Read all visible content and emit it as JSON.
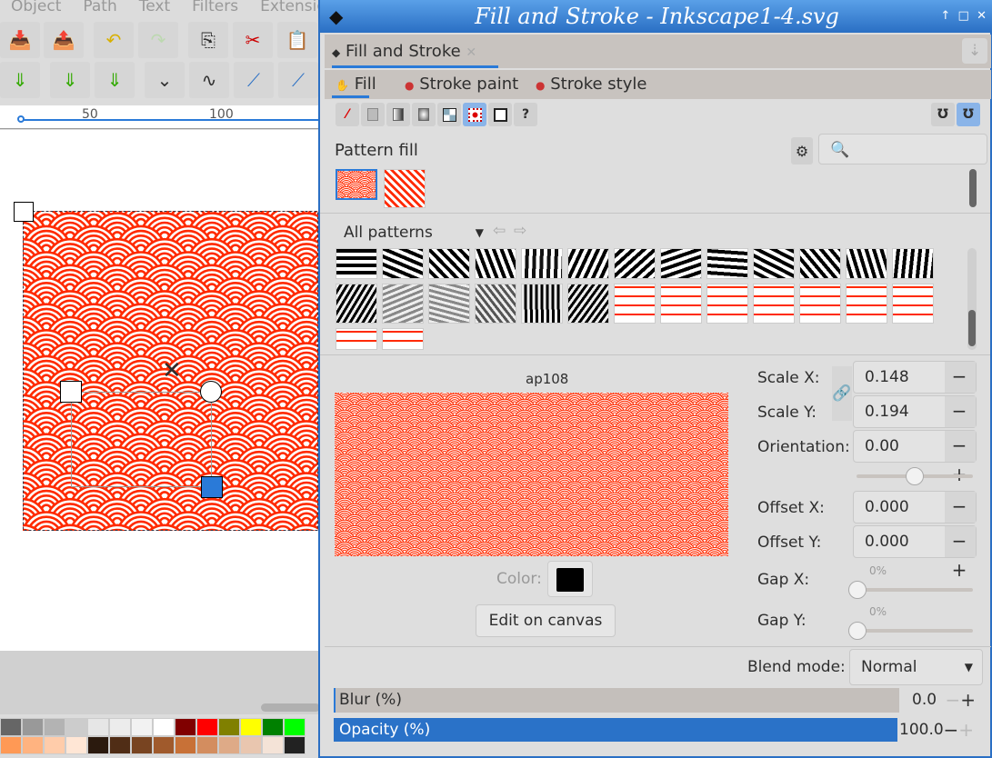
{
  "main": {
    "menu": [
      "Object",
      "Path",
      "Text",
      "Filters",
      "Extensions"
    ],
    "ruler": [
      "50",
      "100"
    ]
  },
  "dialog": {
    "title": "Fill and Stroke - Inkscape1-4.svg",
    "window_controls": [
      "↑",
      "□",
      "✕"
    ],
    "tab": "Fill and Stroke",
    "subtabs": [
      "Fill",
      "Stroke paint",
      "Stroke style"
    ],
    "paint_modes": [
      "no-paint",
      "flat-color",
      "linear-gradient",
      "radial-gradient",
      "mesh-gradient",
      "pattern",
      "swatch",
      "unset"
    ],
    "selected_mode": "pattern",
    "section": "Pattern fill",
    "search_placeholder": "",
    "collection": "All patterns",
    "pattern_name": "ap108",
    "color_label": "Color:",
    "pattern_color": "#000000",
    "edit_button": "Edit on canvas",
    "scale_x_label": "Scale X:",
    "scale_x": "0.148",
    "scale_y_label": "Scale Y:",
    "scale_y": "0.194",
    "orientation_label": "Orientation:",
    "orientation": "0.00",
    "orientation_slider": 0.5,
    "offset_x_label": "Offset X:",
    "offset_x": "0.000",
    "offset_y_label": "Offset Y:",
    "offset_y": "0.000",
    "gap_x_label": "Gap X:",
    "gap_x": "0%",
    "gap_y_label": "Gap Y:",
    "gap_y": "0%",
    "blend_label": "Blend mode:",
    "blend": "Normal",
    "blur_label": "Blur (%)",
    "blur": "0.0",
    "opacity_label": "Opacity (%)",
    "opacity": "100.0"
  },
  "colors": {
    "accent": "#2a7ad8",
    "pattern_red": "#ff2a00"
  }
}
